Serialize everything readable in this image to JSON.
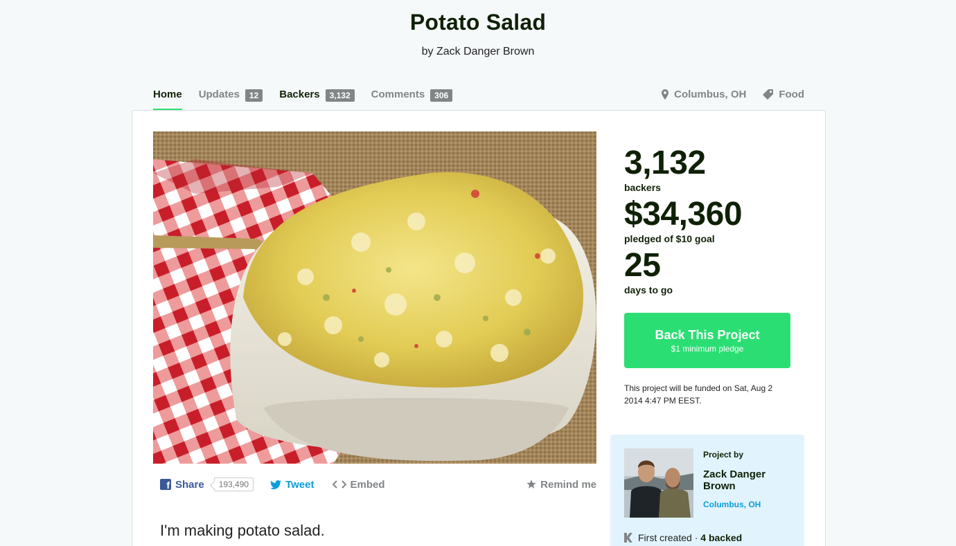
{
  "project": {
    "title": "Potato Salad",
    "byline": "by Zack Danger Brown"
  },
  "tabs": [
    {
      "label": "Home",
      "count": null
    },
    {
      "label": "Updates",
      "count": "12"
    },
    {
      "label": "Backers",
      "count": "3,132"
    },
    {
      "label": "Comments",
      "count": "306"
    }
  ],
  "meta": {
    "location": "Columbus, OH",
    "category": "Food"
  },
  "share": {
    "share_label": "Share",
    "share_count": "193,490",
    "tweet_label": "Tweet",
    "embed_label": "Embed",
    "remind_label": "Remind me"
  },
  "blurb": "I'm making potato salad.",
  "stats": {
    "backers_num": "3,132",
    "backers_label": "backers",
    "pledged_num": "$34,360",
    "pledged_label": "pledged of $10 goal",
    "days_num": "25",
    "days_label": "days to go"
  },
  "cta": {
    "label": "Back This Project",
    "sub": "$1 minimum pledge"
  },
  "funded_note": "This project will be funded on Sat, Aug 2 2014 4:47 PM EEST.",
  "creator": {
    "project_by": "Project by",
    "name": "Zack Danger Brown",
    "location": "Columbus, OH",
    "first_created": "First created",
    "separator": "·",
    "backed": "4 backed"
  },
  "colors": {
    "accent_green": "#2bde73",
    "twitter_blue": "#0a9ed9",
    "facebook_blue": "#3b5998",
    "creator_bg": "#e1f4fd"
  },
  "icons": {
    "location": "map-pin-icon",
    "category": "tag-icon",
    "facebook": "facebook-icon",
    "twitter": "twitter-bird-icon",
    "embed": "code-brackets-icon",
    "remind": "star-icon",
    "kickstarter": "kickstarter-k-icon"
  }
}
